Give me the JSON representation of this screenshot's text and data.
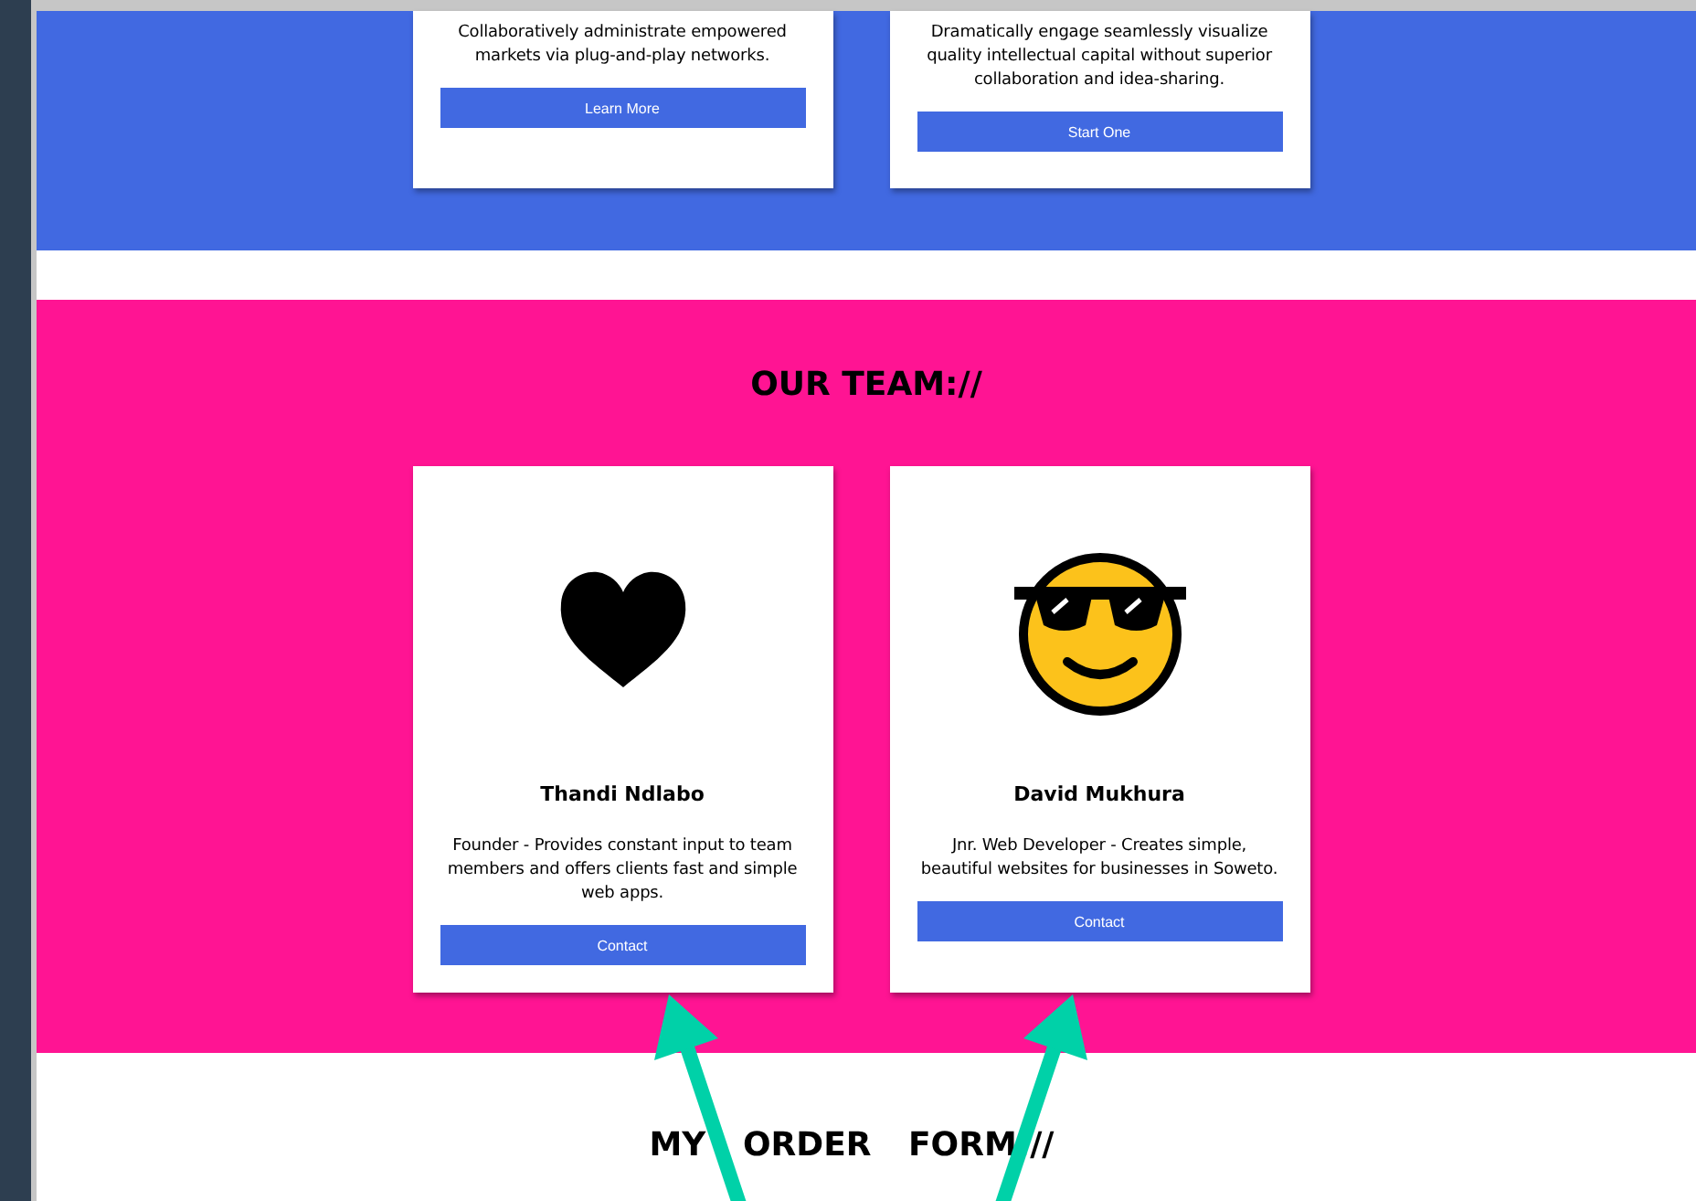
{
  "services": [
    {
      "description": "Collaboratively administrate empowered markets via plug-and-play networks.",
      "button": "Learn More"
    },
    {
      "description": "Dramatically engage seamlessly visualize quality intellectual capital without superior collaboration and idea-sharing.",
      "button": "Start One"
    }
  ],
  "team": {
    "heading": "OUR TEAM://",
    "members": [
      {
        "kind": "heart",
        "name": "Thandi Ndlabo",
        "description": "Founder - Provides constant input to team members and offers clients fast and simple web apps.",
        "button": "Contact"
      },
      {
        "kind": "sunglasses",
        "name": "David Mukhura",
        "description": "Jnr. Web Developer - Creates simple, beautiful websites for businesses in Soweto.",
        "button": "Contact"
      }
    ]
  },
  "order_form": {
    "heading": "MY ORDER FORM://"
  }
}
